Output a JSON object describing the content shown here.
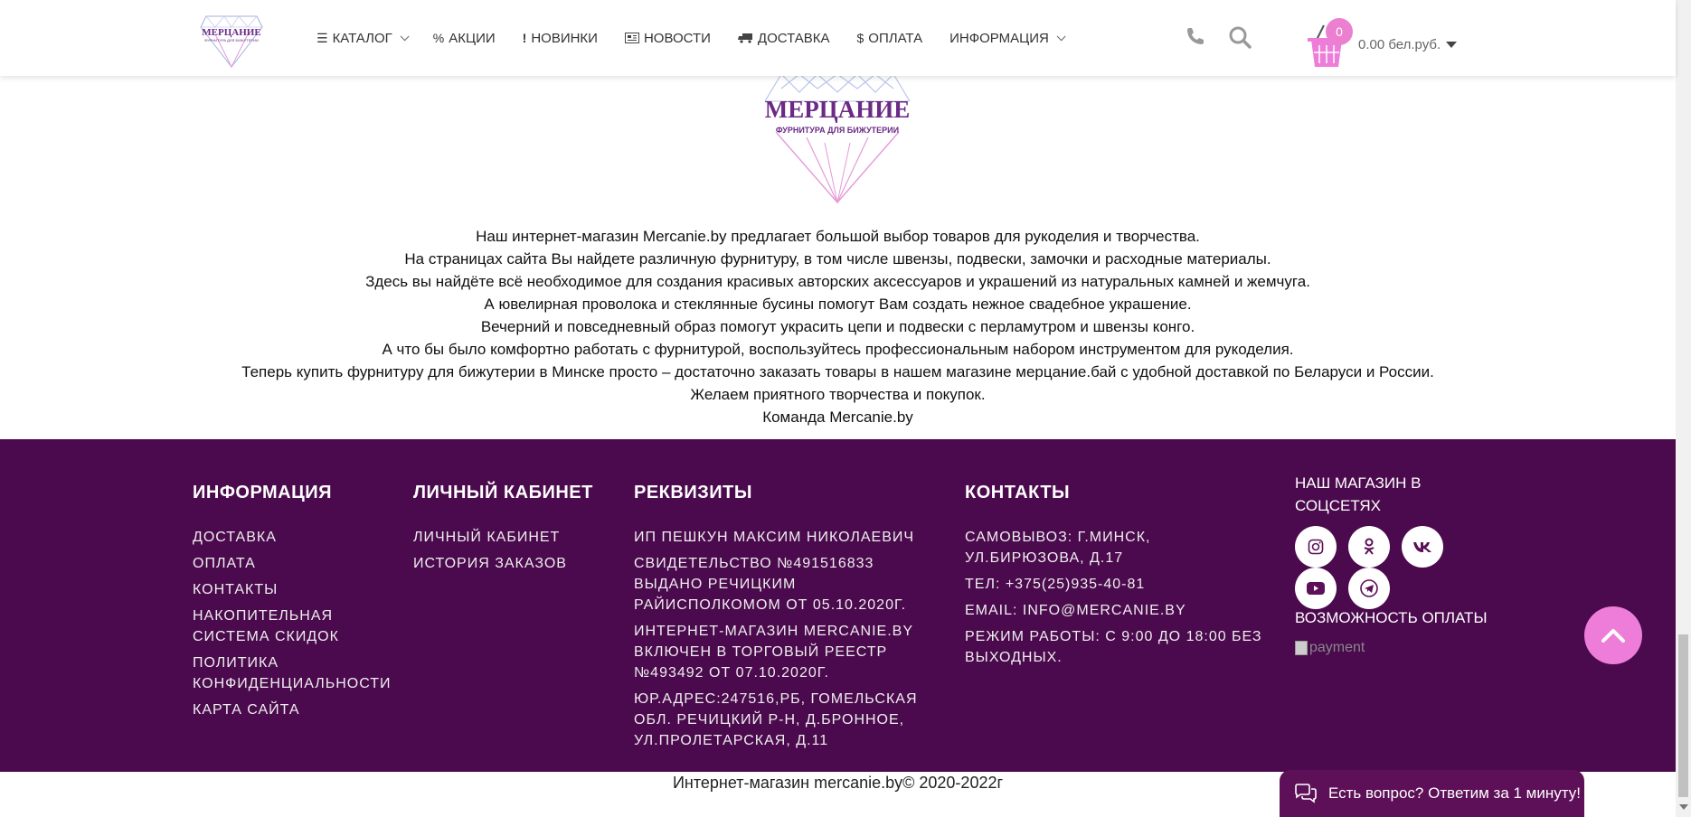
{
  "header": {
    "logo_text": "МЕРЦАНИЕ",
    "logo_sub": "ФУРНИТУРА ДЛЯ БИЖУТЕРИИ",
    "nav": [
      {
        "label": "КАТАЛОГ",
        "icon": "bars-icon",
        "dropdown": true
      },
      {
        "label": "АКЦИИ",
        "icon": "percent-icon",
        "dropdown": false
      },
      {
        "label": "НОВИНКИ",
        "icon": "exclamation-icon",
        "dropdown": false
      },
      {
        "label": "НОВОСТИ",
        "icon": "newspaper-icon",
        "dropdown": false
      },
      {
        "label": "ДОСТАВКА",
        "icon": "truck-icon",
        "dropdown": false
      },
      {
        "label": "ОПЛАТА",
        "icon": "dollar-icon",
        "dropdown": false
      },
      {
        "label": "ИНФОРМАЦИЯ",
        "icon": "",
        "dropdown": true
      }
    ],
    "cart_count": "0",
    "cart_total": "0.00 бел.руб."
  },
  "main": {
    "logo_text": "МЕРЦАНИЕ",
    "logo_sub": "ФУРНИТУРА ДЛЯ БИЖУТЕРИИ",
    "about_lines": [
      "Наш интернет-магазин Mercanie.by предлагает большой выбор товаров для рукоделия и творчества.",
      "На страницах сайта Вы найдете различную фурнитуру, в том числе швензы, подвески, замочки и расходные материалы.",
      "Здесь вы найдёте всё необходимое для создания красивых авторских аксессуаров и украшений из натуральных камней и жемчуга.",
      "А ювелирная проволока и стеклянные бусины помогут Вам создать нежное свадебное украшение.",
      "Вечерний и повседневный образ помогут украсить цепи и подвески с перламутром и швензы конго.",
      "А что бы было комфортно работать с фурнитурой, воспользуйтесь профессиональным набором инструментом для рукоделия.",
      "Теперь купить фурнитуру для бижутерии в Минске просто – достаточно заказать товары в нашем магазине мерцание.бай с удобной доставкой по Беларуси и России.",
      "Желаем приятного творчества и покупок.",
      "Команда Mercanie.by"
    ]
  },
  "footer": {
    "info": {
      "title": "ИНФОРМАЦИЯ",
      "links": [
        "ДОСТАВКА",
        "ОПЛАТА",
        "КОНТАКТЫ",
        "НАКОПИТЕЛЬНАЯ СИСТЕМА СКИДОК",
        "ПОЛИТИКА КОНФИДЕНЦИАЛЬНОСТИ",
        "КАРТА САЙТА"
      ]
    },
    "cabinet": {
      "title": "ЛИЧНЫЙ КАБИНЕТ",
      "links": [
        "ЛИЧНЫЙ КАБИНЕТ",
        "ИСТОРИЯ ЗАКАЗОВ"
      ]
    },
    "requisites": {
      "title": "РЕКВИЗИТЫ",
      "lines": [
        "ИП ПЕШКУН МАКСИМ НИКОЛАЕВИЧ",
        "СВИДЕТЕЛЬСТВО №491516833 ВЫДАНО РЕЧИЦКИМ РАЙИСПОЛКОМОМ ОТ 05.10.2020Г.",
        "ИНТЕРНЕТ-МАГАЗИН MERCANIE.BY ВКЛЮЧЕН В ТОРГОВЫЙ РЕЕСТР №493492 ОТ 07.10.2020Г.",
        "ЮР.АДРЕС:247516,РБ, ГОМЕЛЬСКАЯ ОБЛ. РЕЧИЦКИЙ Р-Н, Д.БРОННОЕ, УЛ.ПРОЛЕТАРСКАЯ, Д.11"
      ]
    },
    "contacts": {
      "title": "КОНТАКТЫ",
      "lines": [
        "САМОВЫВОЗ: Г.МИНСК, УЛ.БИРЮЗОВА, Д.17",
        "ТЕЛ: +375(25)935-40-81",
        "EMAIL: INFO@MERCANIE.BY",
        "РЕЖИМ РАБОТЫ: С 9:00 ДО 18:00 БЕЗ ВЫХОДНЫХ."
      ]
    },
    "social": {
      "title": "НАШ МАГАЗИН В СОЦСЕТЯХ",
      "icons": [
        "instagram-icon",
        "odnoklassniki-icon",
        "vk-icon",
        "youtube-icon",
        "telegram-icon"
      ],
      "payment_title": "ВОЗМОЖНОСТЬ ОПЛАТЫ",
      "payment_alt": "payment"
    }
  },
  "copyright": "Интернет-магазин mercanie.by© 2020-2022г",
  "chat": {
    "label": "Есть вопрос? Ответим за 1 минуту!"
  },
  "colors": {
    "accent": "#ee7dd9",
    "footer_bg": "#4b0a4d",
    "chat_bg": "#5d1057",
    "logo_purple": "#6a2a86"
  }
}
